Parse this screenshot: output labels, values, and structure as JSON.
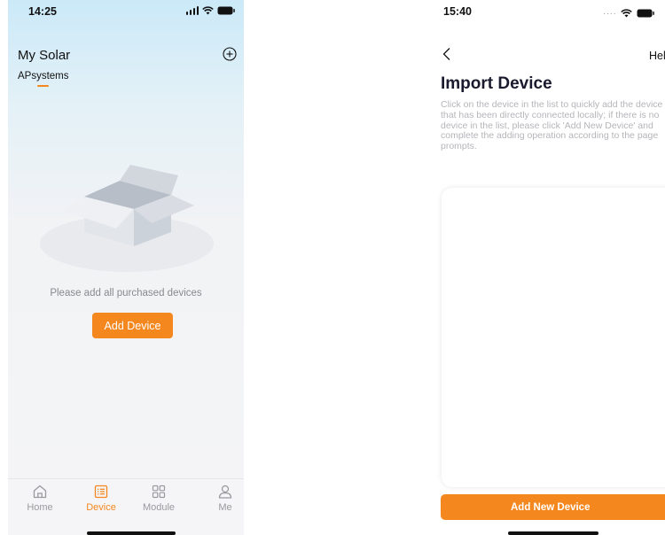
{
  "left_screen": {
    "status": {
      "time": "14:25"
    },
    "header": {
      "title": "My Solar",
      "add_icon": "circle-plus-icon"
    },
    "tabs": [
      {
        "label": "APsystems",
        "active": true
      }
    ],
    "empty_state": {
      "illustration": "empty-box-icon",
      "message": "Please add all purchased devices",
      "button_label": "Add Device"
    },
    "tab_bar": [
      {
        "label": "Home",
        "icon": "home-icon",
        "active": false
      },
      {
        "label": "Device",
        "icon": "list-icon",
        "active": true
      },
      {
        "label": "Module",
        "icon": "grid-icon",
        "active": false
      },
      {
        "label": "Me",
        "icon": "person-icon",
        "active": false
      }
    ]
  },
  "right_screen": {
    "status": {
      "time": "15:40"
    },
    "nav": {
      "back_icon": "chevron-left-icon",
      "help_label": "Help"
    },
    "title": "Import Device",
    "description": "Click on the device in the list to quickly add the device that has been directly connected locally; if there is no device in the list, please click 'Add New Device' and complete the adding operation according to the page prompts.",
    "button_label": "Add New Device"
  },
  "colors": {
    "accent": "#f5871f",
    "header_gradient_top": "#cbe9f8",
    "inactive_tab": "#9a9a9e",
    "description_text": "#b5b5ba"
  }
}
